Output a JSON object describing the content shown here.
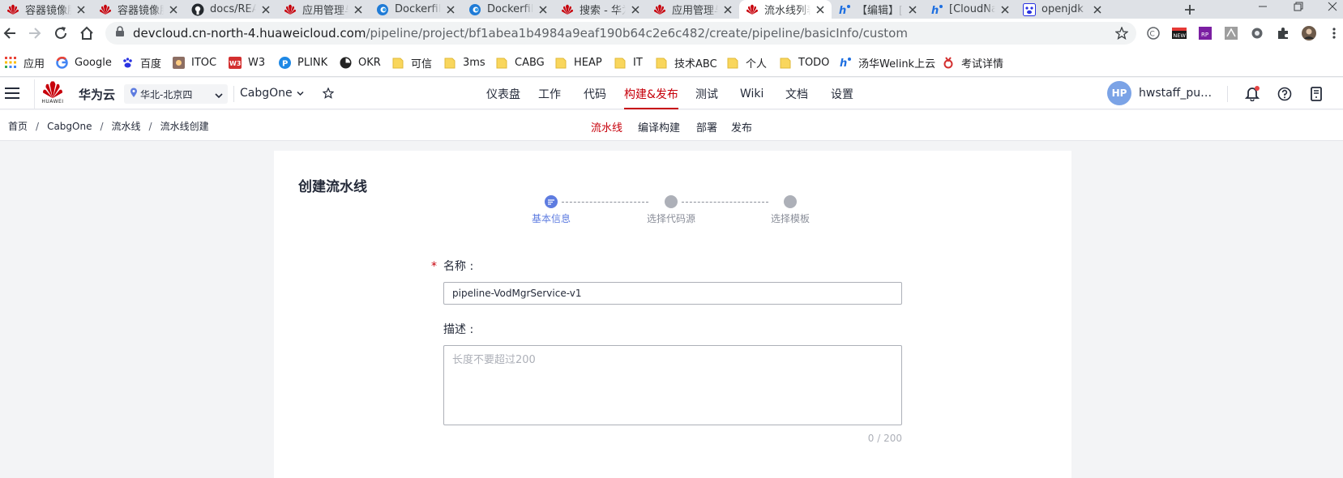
{
  "browser": {
    "tabs": [
      {
        "title": "容器镜像服务",
        "icon": "huawei-logo-icon"
      },
      {
        "title": "容器镜像服务",
        "icon": "huawei-logo-icon"
      },
      {
        "title": "docs/README",
        "icon": "github-icon"
      },
      {
        "title": "应用管理与运维",
        "icon": "huawei-logo-icon"
      },
      {
        "title": "Dockerfile",
        "icon": "edge-icon"
      },
      {
        "title": "Dockerfile",
        "icon": "edge-icon"
      },
      {
        "title": "搜索 - 华为",
        "icon": "huawei-logo-icon"
      },
      {
        "title": "应用管理与运维",
        "icon": "huawei-logo-icon"
      },
      {
        "title": "流水线列表",
        "icon": "huawei-logo-icon",
        "active": true
      },
      {
        "title": "【编辑】[",
        "icon": "welink-icon"
      },
      {
        "title": "[CloudNa",
        "icon": "welink-icon"
      },
      {
        "title": "openjdk",
        "icon": "paw-icon"
      }
    ],
    "url_domain": "devcloud.cn-north-4.huaweicloud.com",
    "url_path": "/pipeline/project/bf1abea1b4984a9eaf190b64c2e6c482/create/pipeline/basicInfo/custom",
    "bookmarks": [
      "应用",
      "Google",
      "百度",
      "ITOC",
      "W3",
      "PLINK",
      "OKR",
      "可信",
      "3ms",
      "CABG",
      "HEAP",
      "IT",
      "技术ABC",
      "个人",
      "TODO",
      "汤华Welink上云",
      "考试详情"
    ]
  },
  "header": {
    "brand_word": "HUAWEI",
    "brand_name": "华为云",
    "region": "华北-北京四",
    "project": "CabgOne",
    "nav": [
      "仪表盘",
      "工作",
      "代码",
      "构建&发布",
      "测试",
      "Wiki",
      "文档",
      "设置"
    ],
    "active_nav": "构建&发布",
    "avatar_initials": "HP",
    "user_name": "hwstaff_pub_cabgone"
  },
  "subheader": {
    "breadcrumb": [
      "首页",
      "CabgOne",
      "流水线",
      "流水线创建"
    ],
    "subnav": [
      "流水线",
      "编译构建",
      "部署",
      "发布"
    ],
    "active_subnav": "流水线"
  },
  "form": {
    "title": "创建流水线",
    "steps": [
      "基本信息",
      "选择代码源",
      "选择模板"
    ],
    "active_step": 0,
    "required_mark": "*",
    "name_label": "名称 :",
    "name_value": "pipeline-VodMgrService-v1",
    "desc_label": "描述 :",
    "desc_placeholder": "长度不要超过200",
    "char_count": "0 / 200"
  },
  "colors": {
    "brand_red": "#c7000b",
    "step_active": "#5e7ce0",
    "step_inactive": "#adb0b8",
    "avatar_bg": "#7ba3e6"
  }
}
